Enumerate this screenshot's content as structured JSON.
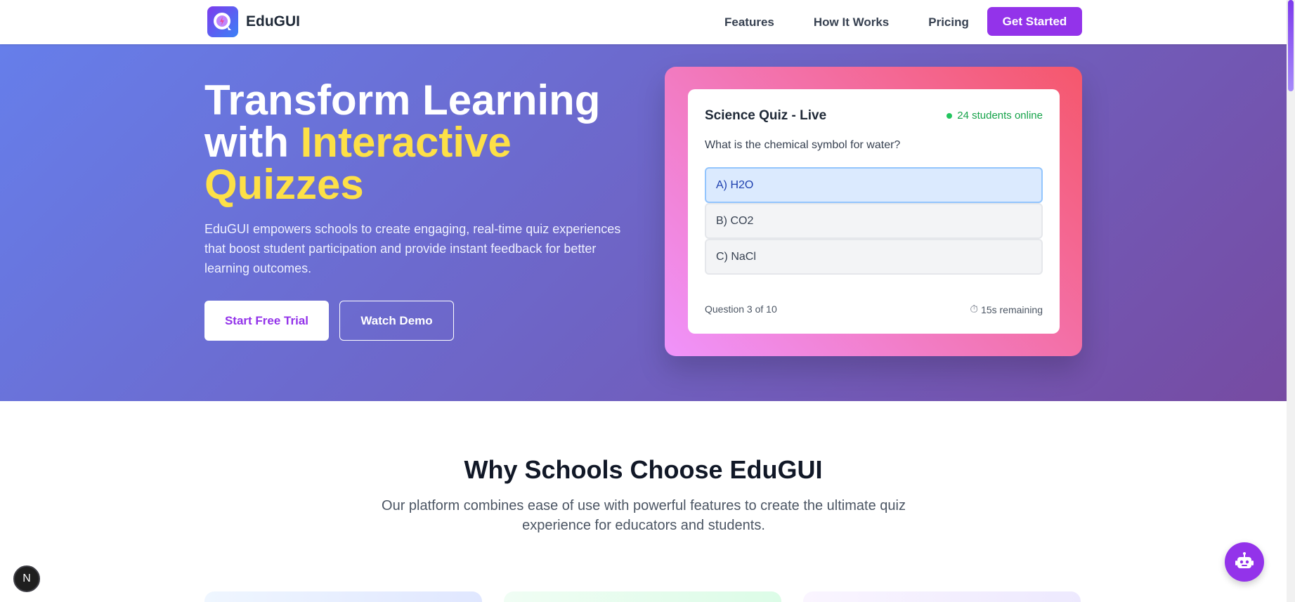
{
  "brand": {
    "name": "EduGUI"
  },
  "nav": {
    "links": [
      "Features",
      "How It Works",
      "Pricing"
    ],
    "cta": "Get Started"
  },
  "hero": {
    "title_line1": "Transform Learning",
    "title_with": "with ",
    "title_accent_1": "Interactive",
    "title_accent_2": "Quizzes",
    "subtitle": "EduGUI empowers schools to create engaging, real-time quiz experiences that boost student participation and provide instant feedback for better learning outcomes.",
    "primary_button": "Start Free Trial",
    "secondary_button": "Watch Demo"
  },
  "quiz": {
    "title": "Science Quiz - Live",
    "online": "24 students online",
    "question": "What is the chemical symbol for water?",
    "options": [
      "A) H2O",
      "B) CO2",
      "C) NaCl"
    ],
    "selected_option_index": 0,
    "progress": "Question 3 of 10",
    "timer_icon": "stopwatch-icon",
    "timer": "15s remaining"
  },
  "why": {
    "title": "Why Schools Choose EduGUI",
    "subtitle": "Our platform combines ease of use with powerful features to create the ultimate quiz experience for educators and students."
  },
  "widgets": {
    "next_badge": "N",
    "bot_icon": "robot-icon"
  },
  "colors": {
    "accent_purple": "#9333ea",
    "hero_gradient_start": "#667eea",
    "hero_gradient_end": "#764ba2",
    "highlight_yellow": "#fde047",
    "quiz_gradient_start": "#f093fb",
    "quiz_gradient_end": "#f5576c",
    "online_green": "#16a34a"
  }
}
